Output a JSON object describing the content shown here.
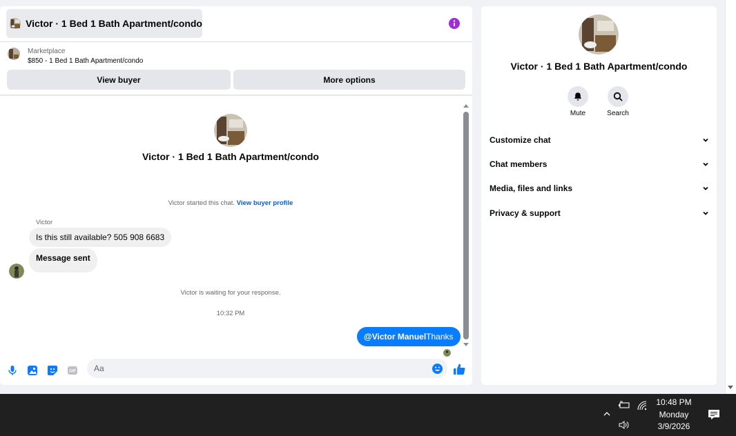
{
  "header": {
    "title": "Victor · 1 Bed 1 Bath Apartment/condo",
    "info_icon": "info-icon"
  },
  "listing": {
    "source": "Marketplace",
    "price_title": "$850 - 1 Bed 1 Bath Apartment/condo"
  },
  "actions": {
    "view_buyer": "View buyer",
    "more_options": "More options"
  },
  "conversation": {
    "title": "Victor · 1 Bed 1 Bath Apartment/condo",
    "started_text": "Victor started this chat.",
    "view_profile": "View buyer profile",
    "sender_name": "Victor",
    "messages_in": [
      "Is this still available? 505 908 6683",
      "Message sent"
    ],
    "waiting_text": "Victor is waiting for your response.",
    "timestamp": "10:32 PM",
    "message_out_mention": "@Victor Manuel",
    "message_out_text": "Thanks"
  },
  "composer": {
    "placeholder": "Aa",
    "icons": [
      "mic-icon",
      "photo-icon",
      "sticker-icon",
      "gif-icon",
      "emoji-icon",
      "like-icon"
    ]
  },
  "info_panel": {
    "title": "Victor · 1 Bed 1 Bath Apartment/condo",
    "mute_label": "Mute",
    "search_label": "Search",
    "sections": [
      "Customize chat",
      "Chat members",
      "Media, files and links",
      "Privacy & support"
    ]
  },
  "taskbar": {
    "time": "10:48 PM",
    "day": "Monday",
    "date": "3/9/2026"
  },
  "colors": {
    "accent": "#0a7cff",
    "info": "#a12cd9",
    "link": "#0a5cc7"
  }
}
